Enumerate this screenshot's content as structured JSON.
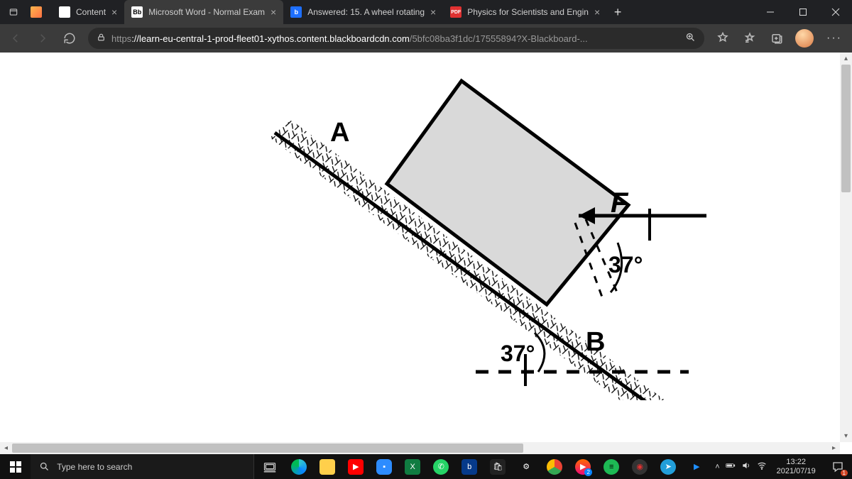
{
  "browser": {
    "tabs": [
      {
        "label": "Content",
        "fav": "",
        "favbg": "#fff"
      },
      {
        "label": "Microsoft Word - Normal Exam",
        "fav": "Bb",
        "favbg": "#fff",
        "favcolor": "#000"
      },
      {
        "label": "Answered: 15. A wheel rotating",
        "fav": "b",
        "favbg": "#1e6fff",
        "favcolor": "#fff"
      },
      {
        "label": "Physics for Scientists and Engin",
        "fav": "PDF",
        "favbg": "#e03131",
        "favcolor": "#fff"
      }
    ],
    "activeTab": 1,
    "url_scheme": "https",
    "url_host": "://learn-eu-central-1-prod-fleet01-xythos.content.blackboardcdn.com",
    "url_path": "/5bfc08ba3f1dc/17555894?X-Blackboard-...",
    "newtab": "+"
  },
  "diagram": {
    "labelA": "A",
    "labelB": "B",
    "labelF": "F",
    "angle1": "37°",
    "angle2": "37°"
  },
  "taskbar": {
    "search_placeholder": "Type here to search",
    "time": "13:22",
    "date": "2021/07/19",
    "notif_count": "1",
    "tray_expand": "˄"
  }
}
